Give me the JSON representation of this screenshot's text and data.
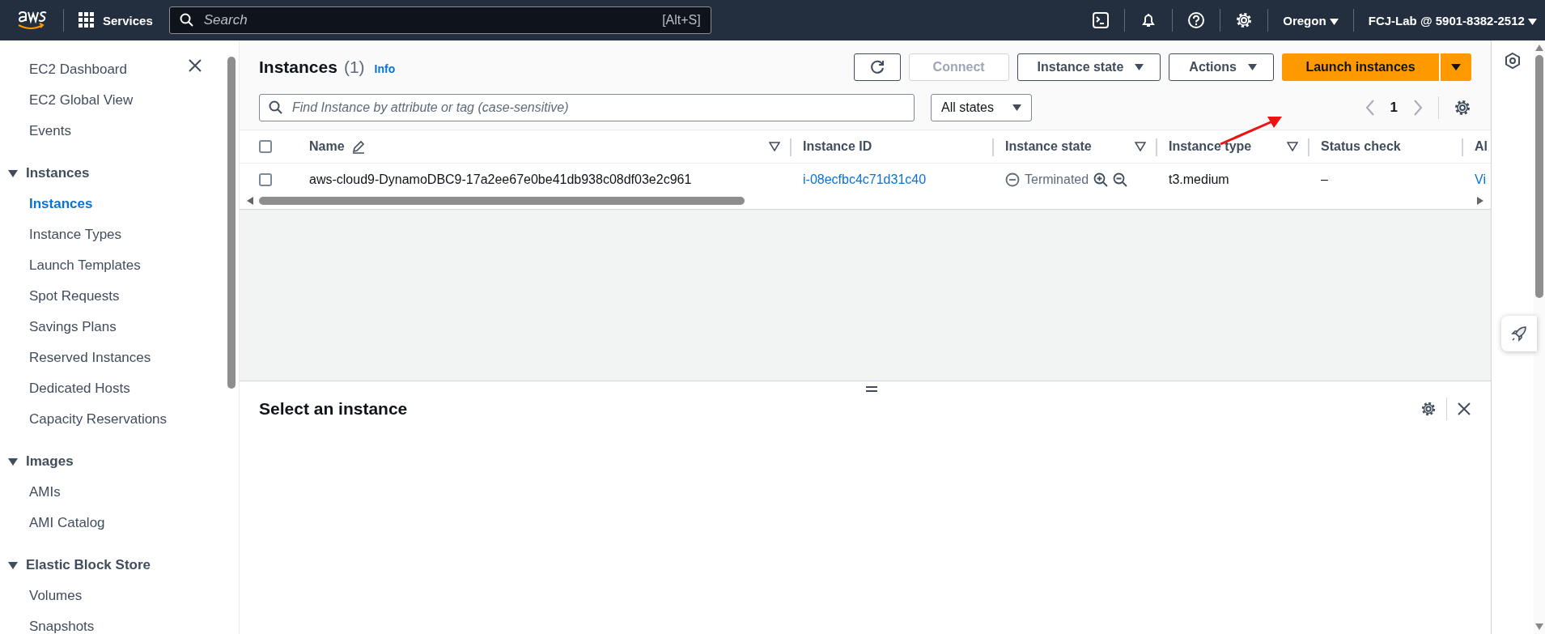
{
  "header": {
    "services": "Services",
    "search": {
      "placeholder": "Search",
      "shortcut": "[Alt+S]"
    },
    "region": "Oregon",
    "account": "FCJ-Lab @ 5901-8382-2512"
  },
  "sidebar": {
    "items": [
      {
        "kind": "link",
        "label": "EC2 Dashboard",
        "selected": false
      },
      {
        "kind": "link",
        "label": "EC2 Global View",
        "selected": false
      },
      {
        "kind": "link",
        "label": "Events",
        "selected": false
      },
      {
        "kind": "section",
        "label": "Instances",
        "expanded": true,
        "children": [
          {
            "kind": "link",
            "label": "Instances",
            "selected": true
          },
          {
            "kind": "link",
            "label": "Instance Types",
            "selected": false
          },
          {
            "kind": "link",
            "label": "Launch Templates",
            "selected": false
          },
          {
            "kind": "link",
            "label": "Spot Requests",
            "selected": false
          },
          {
            "kind": "link",
            "label": "Savings Plans",
            "selected": false
          },
          {
            "kind": "link",
            "label": "Reserved Instances",
            "selected": false
          },
          {
            "kind": "link",
            "label": "Dedicated Hosts",
            "selected": false
          },
          {
            "kind": "link",
            "label": "Capacity Reservations",
            "selected": false
          }
        ]
      },
      {
        "kind": "section",
        "label": "Images",
        "expanded": true,
        "children": [
          {
            "kind": "link",
            "label": "AMIs",
            "selected": false
          },
          {
            "kind": "link",
            "label": "AMI Catalog",
            "selected": false
          }
        ]
      },
      {
        "kind": "section",
        "label": "Elastic Block Store",
        "expanded": true,
        "children": [
          {
            "kind": "link",
            "label": "Volumes",
            "selected": false
          },
          {
            "kind": "link",
            "label": "Snapshots",
            "selected": false
          }
        ]
      }
    ]
  },
  "instances": {
    "title": "Instances",
    "count": "(1)",
    "info": "Info",
    "buttons": [
      {
        "kind": "refresh",
        "disabled": false
      },
      {
        "kind": "text",
        "label": "Connect",
        "disabled": true
      },
      {
        "kind": "dropdown",
        "label": "Instance state",
        "disabled": false
      },
      {
        "kind": "dropdown",
        "label": "Actions",
        "disabled": false
      },
      {
        "kind": "primary",
        "label": "Launch instances",
        "disabled": false
      }
    ],
    "filter": {
      "placeholder": "Find Instance by attribute or tag (case-sensitive)"
    },
    "select_all_checked": false,
    "state_filter": "All states",
    "page": "1",
    "columns": [
      {
        "label": "Name",
        "editable": true,
        "filter": true
      },
      {
        "label": "Instance ID",
        "editable": false,
        "filter": false
      },
      {
        "label": "Instance state",
        "editable": false,
        "filter": true
      },
      {
        "label": "Instance type",
        "editable": false,
        "filter": true
      },
      {
        "label": "Status check",
        "editable": false,
        "filter": false
      },
      {
        "label": "Al"
      }
    ],
    "rows": [
      {
        "checked": false,
        "name": "aws-cloud9-DynamoDBC9-17a2ee67e0be41db938c08df03e2c961",
        "instance_id": "i-08ecfbc4c71d31c40",
        "state": {
          "kind": "terminated",
          "label": "Terminated"
        },
        "type": "t3.medium",
        "status_check": "–",
        "column_6": "Vi"
      }
    ]
  },
  "details": {
    "title": "Select an instance"
  }
}
